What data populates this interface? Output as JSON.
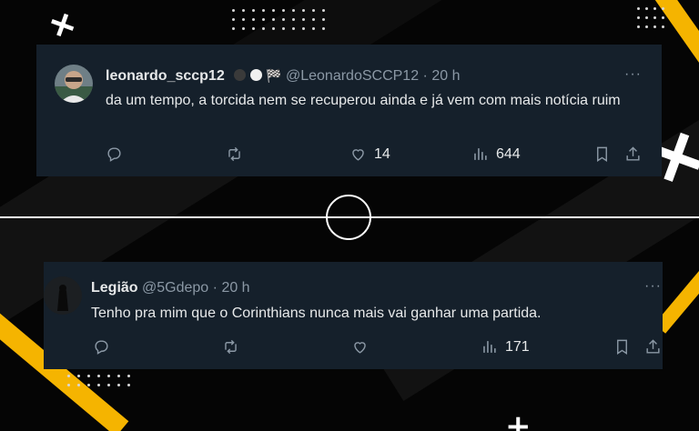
{
  "tweets": [
    {
      "name": "leonardo_sccp12",
      "handle": "@LeonardoSCCP12",
      "time": "20 h",
      "text": "da um tempo, a torcida nem se recuperou ainda e já vem com mais notícia ruim",
      "replies": "",
      "retweets": "",
      "likes": "14",
      "views": "644"
    },
    {
      "name": "Legião",
      "handle": "@5Gdepo",
      "time": "20 h",
      "text": "Tenho pra mim que o Corinthians nunca mais vai ganhar uma partida.",
      "replies": "",
      "retweets": "",
      "likes": "",
      "views": "171"
    }
  ],
  "separator": "·",
  "more": "···",
  "icons": {
    "reply": "reply-icon",
    "retweet": "retweet-icon",
    "like": "heart-icon",
    "views": "views-icon",
    "bookmark": "bookmark-icon",
    "share": "share-icon",
    "flag": "checkered-flag-icon"
  },
  "colors": {
    "card_bg": "#15202b",
    "text": "#e7e9ea",
    "muted": "#8b98a5",
    "accent_yellow": "#f5b400"
  }
}
